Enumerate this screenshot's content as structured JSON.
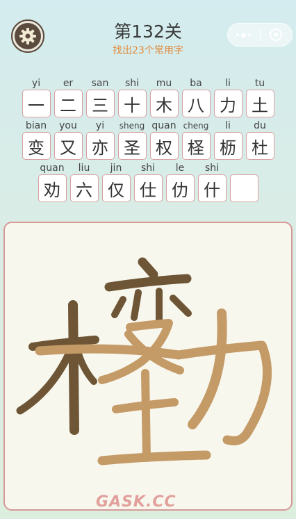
{
  "header": {
    "level_title": "第132关",
    "subtitle": "找出23个常用字",
    "settings_icon": "gear-icon",
    "menu_icon": "more-dots-icon",
    "close_icon": "close-circle-icon"
  },
  "rows": [
    [
      {
        "pinyin": "yi",
        "char": "一"
      },
      {
        "pinyin": "er",
        "char": "二"
      },
      {
        "pinyin": "san",
        "char": "三"
      },
      {
        "pinyin": "shi",
        "char": "十"
      },
      {
        "pinyin": "mu",
        "char": "木"
      },
      {
        "pinyin": "ba",
        "char": "八"
      },
      {
        "pinyin": "li",
        "char": "力"
      },
      {
        "pinyin": "tu",
        "char": "土"
      }
    ],
    [
      {
        "pinyin": "bian",
        "char": "变"
      },
      {
        "pinyin": "you",
        "char": "又"
      },
      {
        "pinyin": "yi",
        "char": "亦"
      },
      {
        "pinyin": "sheng",
        "char": "圣"
      },
      {
        "pinyin": "quan",
        "char": "权"
      },
      {
        "pinyin": "cheng",
        "char": "柽"
      },
      {
        "pinyin": "li",
        "char": "枥"
      },
      {
        "pinyin": "du",
        "char": "杜"
      }
    ],
    [
      {
        "pinyin": "quan",
        "char": "劝"
      },
      {
        "pinyin": "liu",
        "char": "六"
      },
      {
        "pinyin": "jin",
        "char": "仅"
      },
      {
        "pinyin": "shi",
        "char": "仕"
      },
      {
        "pinyin": "le",
        "char": "仂"
      },
      {
        "pinyin": "shi",
        "char": "什"
      },
      {
        "pinyin": "",
        "char": ""
      }
    ]
  ],
  "colors": {
    "stroke_dark": "#6e5535",
    "stroke_light": "#c49a66",
    "tile_border": "#d9a0a0",
    "board_border": "#d59a97",
    "subtitle": "#e08a3a"
  },
  "watermark": "GASK.CC"
}
